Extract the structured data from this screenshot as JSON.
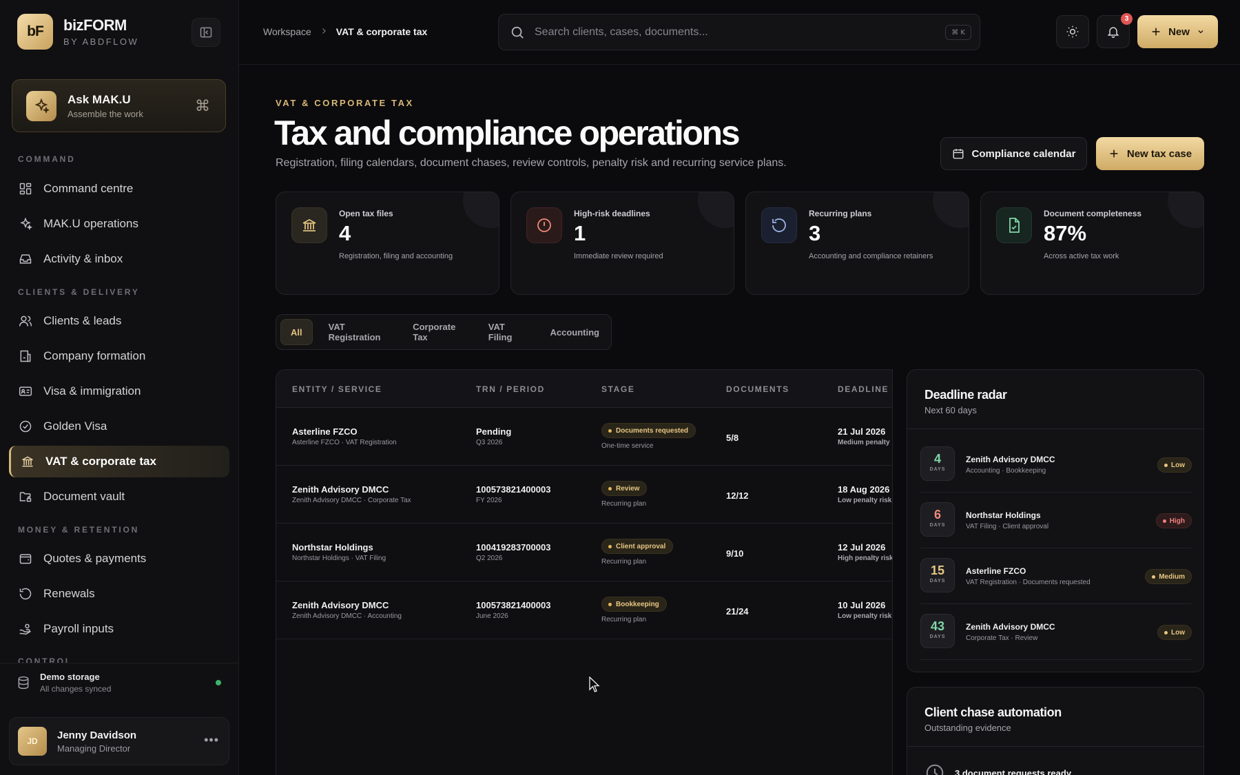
{
  "brand": {
    "logo": "bF",
    "name": "bizFORM",
    "sub": "BY ABDFLOW"
  },
  "ask": {
    "title": "Ask MAK.U",
    "sub": "Assemble the work",
    "icon": "sparkle-icon",
    "shortcut_icon": "command-icon"
  },
  "sidebar": {
    "sections": {
      "command": "COMMAND",
      "clients": "CLIENTS & DELIVERY",
      "money": "MONEY & RETENTION",
      "control": "CONTROL"
    },
    "items": [
      {
        "label": "Command centre",
        "icon": "grid-icon"
      },
      {
        "label": "MAK.U operations",
        "icon": "sparkle-icon"
      },
      {
        "label": "Activity & inbox",
        "icon": "inbox-icon"
      },
      {
        "label": "Clients & leads",
        "icon": "users-icon"
      },
      {
        "label": "Company formation",
        "icon": "building-icon"
      },
      {
        "label": "Visa & immigration",
        "icon": "id-card-icon"
      },
      {
        "label": "Golden Visa",
        "icon": "badge-check-icon"
      },
      {
        "label": "VAT & corporate tax",
        "icon": "bank-icon",
        "active": true
      },
      {
        "label": "Document vault",
        "icon": "folder-lock-icon"
      },
      {
        "label": "Quotes & payments",
        "icon": "wallet-icon"
      },
      {
        "label": "Renewals",
        "icon": "rotate-icon"
      },
      {
        "label": "Payroll inputs",
        "icon": "hand-coins-icon"
      }
    ],
    "storage": {
      "title": "Demo storage",
      "sub": "All changes synced",
      "status_color": "#3bb46b"
    },
    "user": {
      "initials": "JD",
      "name": "Jenny Davidson",
      "role": "Managing Director"
    }
  },
  "topbar": {
    "breadcrumb": [
      "Workspace",
      "VAT & corporate tax"
    ],
    "search": {
      "placeholder": "Search clients, cases, documents...",
      "shortcut": "⌘ K"
    },
    "notifications_count": "3",
    "new_label": "New"
  },
  "page": {
    "eyebrow": "VAT & CORPORATE TAX",
    "title": "Tax and compliance operations",
    "description": "Registration, filing calendars, document chases, review controls, penalty risk and recurring service plans.",
    "calendar_button": "Compliance calendar",
    "new_case_button": "New tax case"
  },
  "stats": [
    {
      "label": "Open tax files",
      "value": "4",
      "sub": "Registration, filing and accounting",
      "icon": "bank-icon"
    },
    {
      "label": "High-risk deadlines",
      "value": "1",
      "sub": "Immediate review required",
      "icon": "alert-circle-icon"
    },
    {
      "label": "Recurring plans",
      "value": "3",
      "sub": "Accounting and compliance retainers",
      "icon": "rotate-icon"
    },
    {
      "label": "Document completeness",
      "value": "87%",
      "sub": "Across active tax work",
      "icon": "file-check-icon"
    }
  ],
  "tabs": [
    "All",
    "VAT Registration",
    "Corporate Tax",
    "VAT Filing",
    "Accounting"
  ],
  "table": {
    "headers": [
      "ENTITY / SERVICE",
      "TRN / PERIOD",
      "STAGE",
      "DOCUMENTS",
      "DEADLINE /"
    ],
    "rows": [
      {
        "entity": "Asterline FZCO",
        "service": "Asterline FZCO · VAT Registration",
        "trn": "Pending",
        "period": "Q3 2026",
        "stage": "Documents requested",
        "plan": "One-time service",
        "docs": "5/8",
        "deadline": "21 Jul 2026",
        "penalty": "Medium penalty"
      },
      {
        "entity": "Zenith Advisory DMCC",
        "service": "Zenith Advisory DMCC · Corporate Tax",
        "trn": "100573821400003",
        "period": "FY 2026",
        "stage": "Review",
        "plan": "Recurring plan",
        "docs": "12/12",
        "deadline": "18 Aug 2026",
        "penalty": "Low penalty risk"
      },
      {
        "entity": "Northstar Holdings",
        "service": "Northstar Holdings · VAT Filing",
        "trn": "100419283700003",
        "period": "Q2 2026",
        "stage": "Client approval",
        "plan": "Recurring plan",
        "docs": "9/10",
        "deadline": "12 Jul 2026",
        "penalty": "High penalty risk"
      },
      {
        "entity": "Zenith Advisory DMCC",
        "service": "Zenith Advisory DMCC · Accounting",
        "trn": "100573821400003",
        "period": "June 2026",
        "stage": "Bookkeeping",
        "plan": "Recurring plan",
        "docs": "21/24",
        "deadline": "10 Jul 2026",
        "penalty": "Low penalty risk"
      }
    ]
  },
  "radar": {
    "title": "Deadline radar",
    "sub": "Next 60 days",
    "days_label": "DAYS",
    "items": [
      {
        "days": "4",
        "color": "#7fd6a8",
        "title": "Zenith Advisory DMCC",
        "sub": "Accounting · Bookkeeping",
        "risk": "Low",
        "level": "low"
      },
      {
        "days": "6",
        "color": "#f08a7a",
        "title": "Northstar Holdings",
        "sub": "VAT Filing · Client approval",
        "risk": "High",
        "level": "high"
      },
      {
        "days": "15",
        "color": "#e7c784",
        "title": "Asterline FZCO",
        "sub": "VAT Registration · Documents requested",
        "risk": "Medium",
        "level": "medium"
      },
      {
        "days": "43",
        "color": "#7fd6a8",
        "title": "Zenith Advisory DMCC",
        "sub": "Corporate Tax · Review",
        "risk": "Low",
        "level": "low"
      }
    ]
  },
  "chase": {
    "title": "Client chase automation",
    "sub": "Outstanding evidence",
    "item": "3 document requests ready"
  }
}
